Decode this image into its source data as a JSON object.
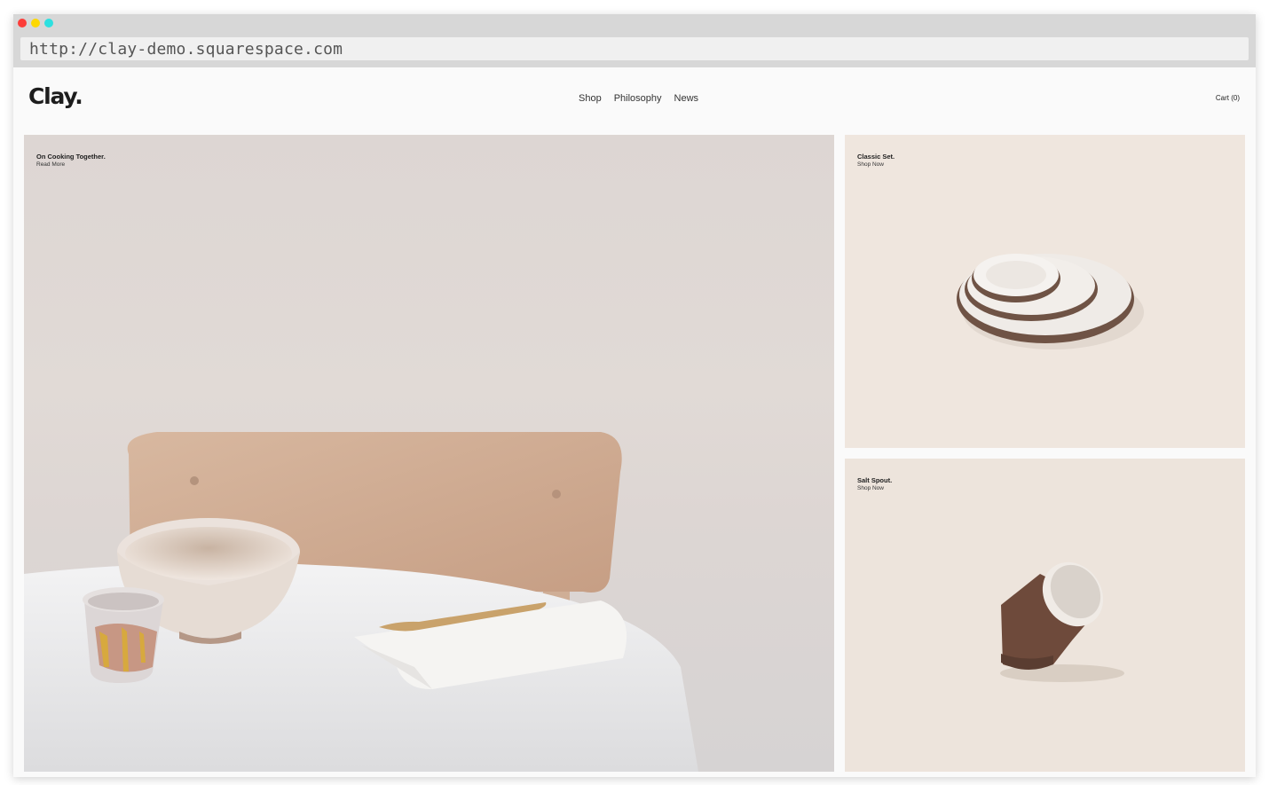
{
  "browser": {
    "url": "http://clay-demo.squarespace.com"
  },
  "site": {
    "logo": "Clay.",
    "nav": [
      "Shop",
      "Philosophy",
      "News"
    ],
    "cart": "Cart (0)"
  },
  "tiles": [
    {
      "title": "On Cooking Together.",
      "link": "Read More"
    },
    {
      "title": "Classic Set.",
      "link": "Shop Now"
    },
    {
      "title": "Salt Spout.",
      "link": "Shop Now"
    }
  ],
  "colors": {
    "page_bg": "#fafafa",
    "browser_chrome": "#d7d7d7",
    "tile_beige": "#efe6de",
    "text_dark": "#1d1d1d"
  }
}
